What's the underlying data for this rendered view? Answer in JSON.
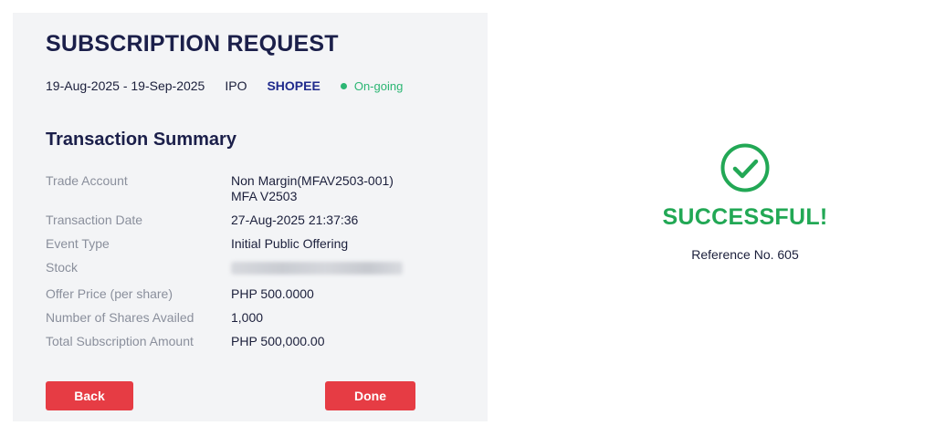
{
  "header": {
    "title": "SUBSCRIPTION REQUEST",
    "period": "19-Aug-2025 - 19-Sep-2025",
    "event_type_short": "IPO",
    "symbol": "SHOPEE",
    "status": "On-going",
    "status_color": "#2bb673"
  },
  "summary": {
    "title": "Transaction Summary",
    "rows": [
      {
        "label": "Trade Account",
        "value": "Non Margin(MFAV2503-001)",
        "value2": "MFA V2503"
      },
      {
        "label": "Transaction Date",
        "value": "27-Aug-2025 21:37:36"
      },
      {
        "label": "Event Type",
        "value": "Initial Public Offering"
      },
      {
        "label": "Stock",
        "value": ""
      },
      {
        "label": "Offer Price (per share)",
        "value": "PHP 500.0000"
      },
      {
        "label": "Number of Shares Availed",
        "value": "1,000"
      },
      {
        "label": "Total Subscription Amount",
        "value": "PHP 500,000.00"
      }
    ]
  },
  "buttons": {
    "back_label": "Back",
    "done_label": "Done",
    "color": "#e63c44"
  },
  "result": {
    "icon": "check-circle-icon",
    "headline": "SUCCESSFUL!",
    "reference": "Reference No. 605",
    "color": "#22a855"
  }
}
